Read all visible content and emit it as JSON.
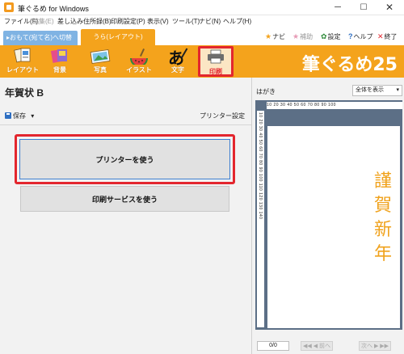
{
  "window": {
    "title": "筆ぐるめ for Windows",
    "minimize": "─",
    "maximize": "☐",
    "close": "✕"
  },
  "menu": [
    {
      "label": "ファイル(F)",
      "enabled": true
    },
    {
      "label": "編集(E)",
      "enabled": false
    },
    {
      "label": "差し込み住所録(B)",
      "enabled": true
    },
    {
      "label": "印刷設定(P)",
      "enabled": true
    },
    {
      "label": "表示(V)",
      "enabled": true
    },
    {
      "label": "ツール(T)",
      "enabled": true
    },
    {
      "label": "ナビ(N)",
      "enabled": true
    },
    {
      "label": "ヘルプ(H)",
      "enabled": true
    }
  ],
  "tabs": {
    "front": "▸おもて(宛て名)へ切替",
    "back": "うら(レイアウト)"
  },
  "tools": {
    "navi": {
      "icon": "★",
      "label": "ナビ"
    },
    "hojo": {
      "icon": "★",
      "label": "補助"
    },
    "settings": {
      "icon": "✿",
      "label": "設定"
    },
    "help": {
      "icon": "?",
      "label": "ヘルプ"
    },
    "exit": {
      "icon": "✕",
      "label": "終了"
    }
  },
  "toolbar": {
    "items": [
      {
        "label": "レイアウト",
        "icon": "layout-icon"
      },
      {
        "label": "背景",
        "icon": "background-icon"
      },
      {
        "label": "写真",
        "icon": "photo-icon"
      },
      {
        "label": "イラスト",
        "icon": "illustration-icon"
      },
      {
        "label": "文字",
        "icon": "text-icon"
      },
      {
        "label": "印刷",
        "icon": "print-icon"
      }
    ],
    "text_glyph": "あ",
    "selected": "印刷",
    "brand": "筆ぐるめ25"
  },
  "left": {
    "title": "年賀状 B",
    "save": "保存",
    "save_arrow": "▾",
    "printer_settings": "プリンター設定",
    "use_printer": "プリンターを使う",
    "use_print_service": "印刷サービスを使う"
  },
  "right": {
    "paper": "はがき",
    "view_select": "全体を表示",
    "view_arrow": "▾",
    "ruler_top": "10 20 30 40 50 60 70 80 90 100",
    "ruler_left": "10 20 30 40 50 60 70 80 90 100 110 120 130 140",
    "greeting": [
      "謹",
      "賀",
      "新",
      "年"
    ],
    "page": "0/0",
    "prev": "◀◀ ◀ 前へ",
    "next": "次へ ▶ ▶▶"
  },
  "colors": {
    "accent": "#f4a31c",
    "highlight": "#e3262e",
    "greeting": "#f0a21c",
    "preview_bg": "#5c6f86"
  }
}
